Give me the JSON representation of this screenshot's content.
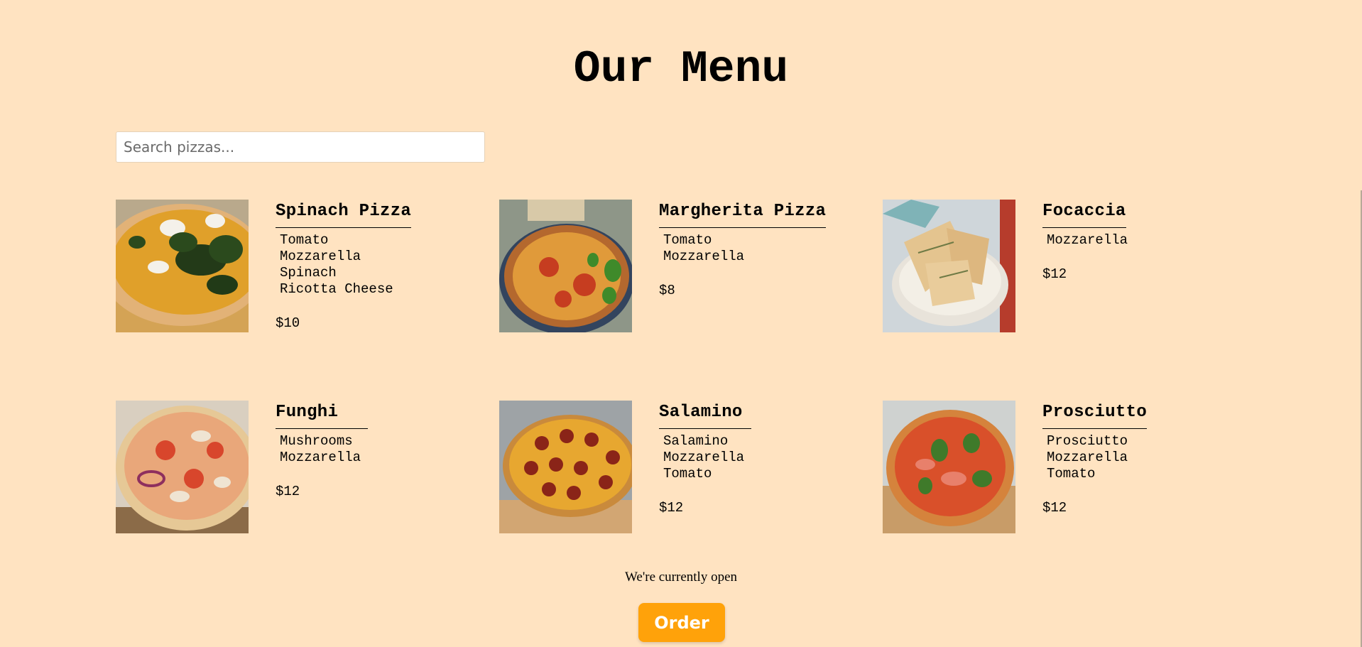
{
  "header": {
    "title": "Our Menu"
  },
  "search": {
    "placeholder": "Search pizzas..."
  },
  "pizzas": [
    {
      "name": "Spinach Pizza",
      "ingredients": [
        "Tomato",
        "Mozzarella",
        "Spinach",
        "Ricotta Cheese"
      ],
      "price": "$10"
    },
    {
      "name": "Margherita Pizza",
      "ingredients": [
        "Tomato",
        "Mozzarella"
      ],
      "price": "$8"
    },
    {
      "name": "Focaccia",
      "ingredients": [
        "Mozzarella"
      ],
      "price": "$12"
    },
    {
      "name": "Funghi",
      "ingredients": [
        "Mushrooms",
        "Mozzarella"
      ],
      "price": "$12"
    },
    {
      "name": "Salamino",
      "ingredients": [
        "Salamino",
        "Mozzarella",
        "Tomato"
      ],
      "price": "$12"
    },
    {
      "name": "Prosciutto",
      "ingredients": [
        "Prosciutto",
        "Mozzarella",
        "Tomato"
      ],
      "price": "$12"
    }
  ],
  "footer": {
    "status": "We're currently open",
    "order_label": "Order"
  },
  "colors": {
    "background": "#ffe3c1",
    "accent": "#ffa20a"
  }
}
